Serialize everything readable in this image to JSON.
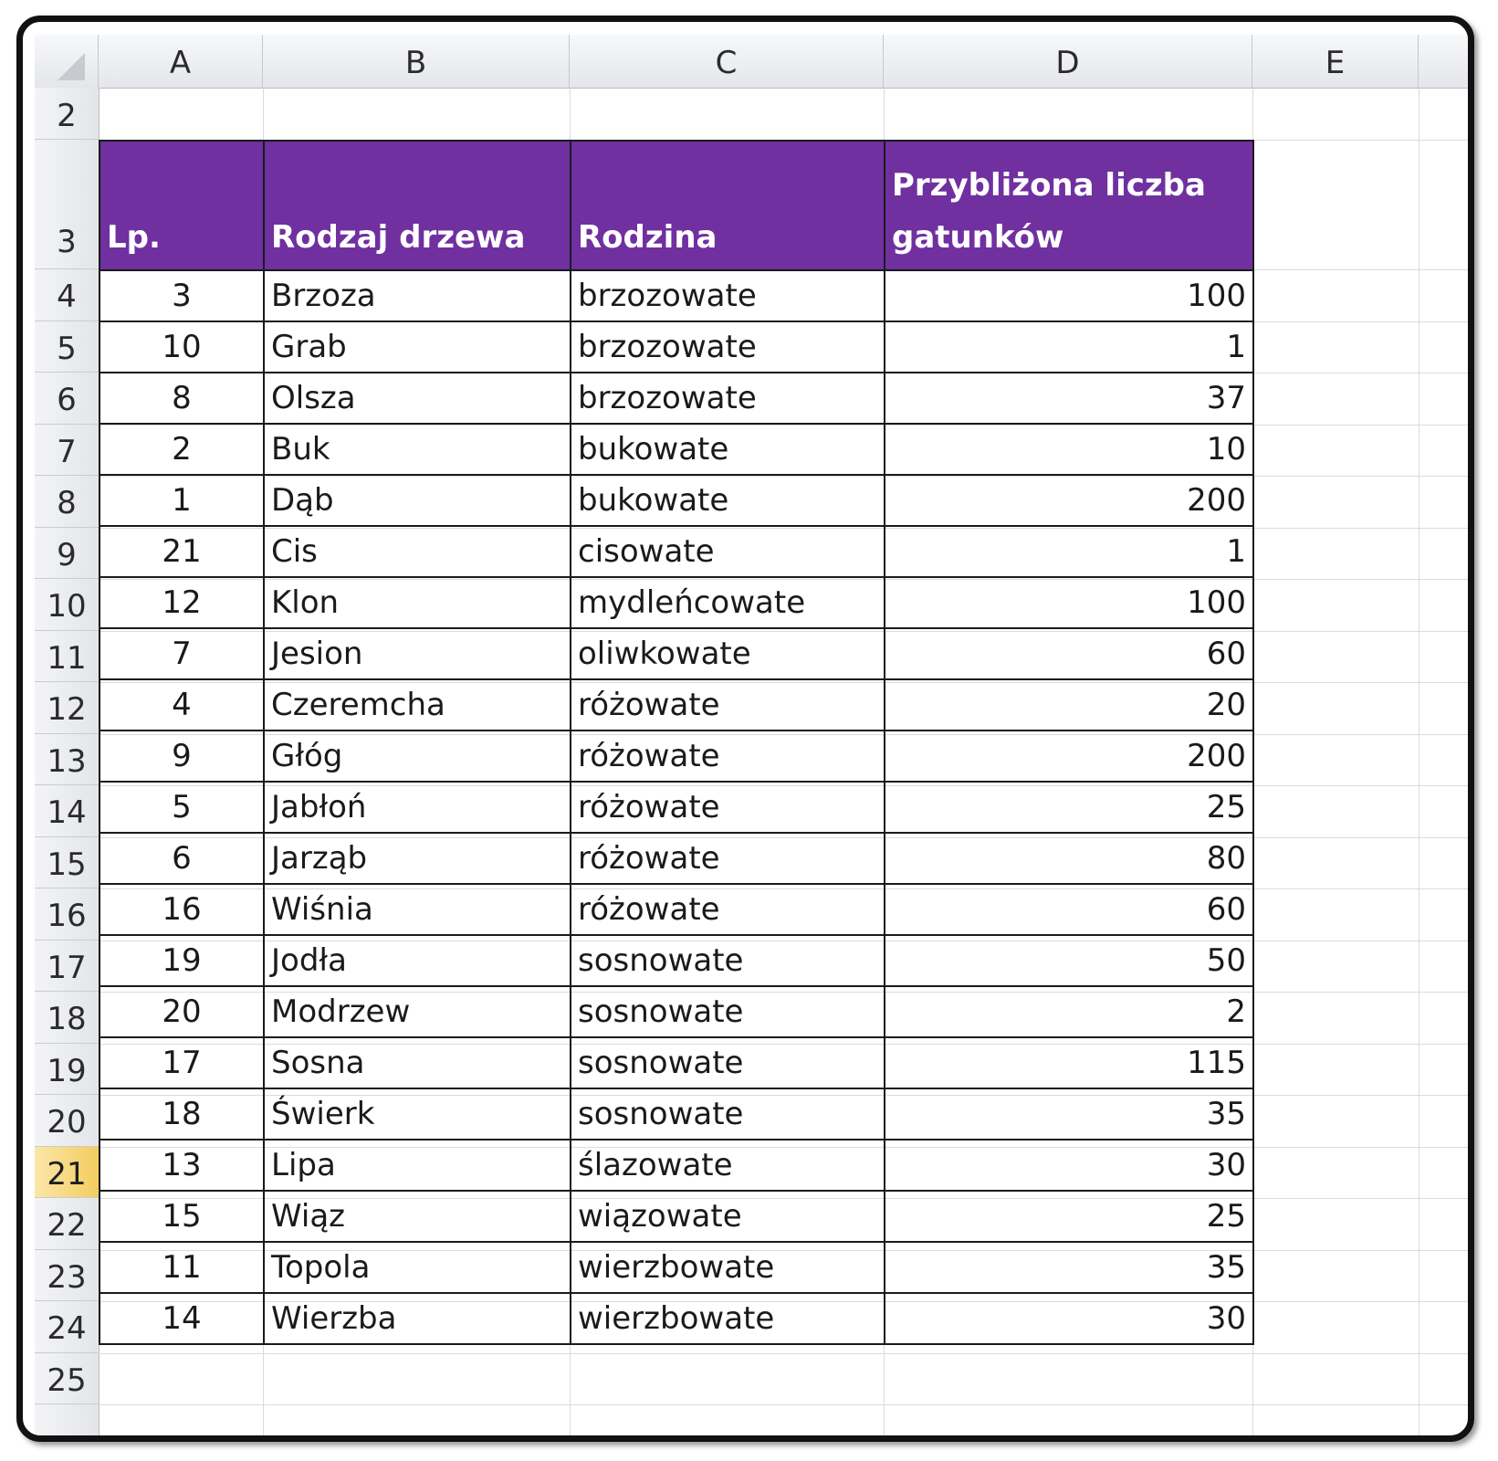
{
  "sheet": {
    "columns": [
      "A",
      "B",
      "C",
      "D",
      "E"
    ],
    "active_row": "21",
    "rows_above_table": [
      "2"
    ],
    "header_row": "3",
    "partial_row": "25"
  },
  "table": {
    "headers": [
      "Lp.",
      "Rodzaj drzewa",
      "Rodzina",
      "Przybliżona liczba gatunków"
    ],
    "rows": [
      {
        "row": "4",
        "lp": "3",
        "rodzaj": "Brzoza",
        "rodzina": "brzozowate",
        "liczba": "100"
      },
      {
        "row": "5",
        "lp": "10",
        "rodzaj": "Grab",
        "rodzina": "brzozowate",
        "liczba": "1"
      },
      {
        "row": "6",
        "lp": "8",
        "rodzaj": "Olsza",
        "rodzina": "brzozowate",
        "liczba": "37"
      },
      {
        "row": "7",
        "lp": "2",
        "rodzaj": "Buk",
        "rodzina": "bukowate",
        "liczba": "10"
      },
      {
        "row": "8",
        "lp": "1",
        "rodzaj": "Dąb",
        "rodzina": "bukowate",
        "liczba": "200"
      },
      {
        "row": "9",
        "lp": "21",
        "rodzaj": "Cis",
        "rodzina": "cisowate",
        "liczba": "1"
      },
      {
        "row": "10",
        "lp": "12",
        "rodzaj": "Klon",
        "rodzina": "mydleńcowate",
        "liczba": "100"
      },
      {
        "row": "11",
        "lp": "7",
        "rodzaj": "Jesion",
        "rodzina": "oliwkowate",
        "liczba": "60"
      },
      {
        "row": "12",
        "lp": "4",
        "rodzaj": "Czeremcha",
        "rodzina": "różowate",
        "liczba": "20"
      },
      {
        "row": "13",
        "lp": "9",
        "rodzaj": "Głóg",
        "rodzina": "różowate",
        "liczba": "200"
      },
      {
        "row": "14",
        "lp": "5",
        "rodzaj": "Jabłoń",
        "rodzina": "różowate",
        "liczba": "25"
      },
      {
        "row": "15",
        "lp": "6",
        "rodzaj": "Jarząb",
        "rodzina": "różowate",
        "liczba": "80"
      },
      {
        "row": "16",
        "lp": "16",
        "rodzaj": "Wiśnia",
        "rodzina": "różowate",
        "liczba": "60"
      },
      {
        "row": "17",
        "lp": "19",
        "rodzaj": "Jodła",
        "rodzina": "sosnowate",
        "liczba": "50"
      },
      {
        "row": "18",
        "lp": "20",
        "rodzaj": "Modrzew",
        "rodzina": "sosnowate",
        "liczba": "2"
      },
      {
        "row": "19",
        "lp": "17",
        "rodzaj": "Sosna",
        "rodzina": "sosnowate",
        "liczba": "115"
      },
      {
        "row": "20",
        "lp": "18",
        "rodzaj": "Świerk",
        "rodzina": "sosnowate",
        "liczba": "35"
      },
      {
        "row": "21",
        "lp": "13",
        "rodzaj": "Lipa",
        "rodzina": "ślazowate",
        "liczba": "30"
      },
      {
        "row": "22",
        "lp": "15",
        "rodzaj": "Wiąz",
        "rodzina": "wiązowate",
        "liczba": "25"
      },
      {
        "row": "23",
        "lp": "11",
        "rodzaj": "Topola",
        "rodzina": "wierzbowate",
        "liczba": "35"
      },
      {
        "row": "24",
        "lp": "14",
        "rodzaj": "Wierzba",
        "rodzina": "wierzbowate",
        "liczba": "30"
      }
    ]
  },
  "colors": {
    "header_fill": "#7030a0",
    "header_text": "#ffffff",
    "active_row_header": "#f4cd5f"
  },
  "icons": {
    "corner": "select-all-triangle-icon"
  }
}
